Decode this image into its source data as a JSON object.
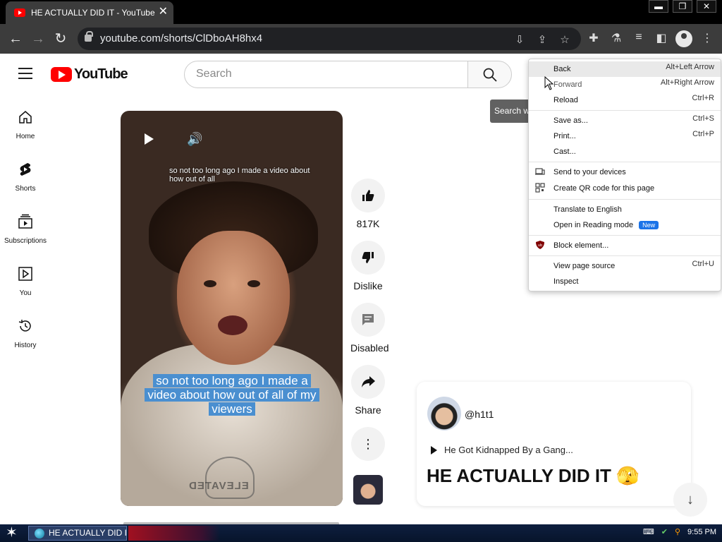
{
  "browser": {
    "tab_title": "HE ACTUALLY DID IT  - YouTube",
    "tab_close": "✕",
    "url": "youtube.com/shorts/ClDboAH8hx4",
    "window_controls": [
      "▬",
      "❐",
      "✕"
    ]
  },
  "youtube": {
    "logo_text": "YouTube",
    "search_placeholder": "Search",
    "search_tooltip": "Search with your voice",
    "sidebar": [
      {
        "label": "Home",
        "icon": "home-icon"
      },
      {
        "label": "Shorts",
        "icon": "shorts-icon"
      },
      {
        "label": "Subscriptions",
        "icon": "subscriptions-icon"
      },
      {
        "label": "You",
        "icon": "you-icon"
      },
      {
        "label": "History",
        "icon": "history-icon"
      }
    ],
    "video": {
      "caption_top": "so not too long ago I made a video about how out of all",
      "caption_main": "so not too long ago I made a video about how out of all of my viewers",
      "shirt_text": "ELEVATED"
    },
    "actions": {
      "like_count": "817K",
      "dislike_label": "Dislike",
      "comments_label": "Disabled",
      "share_label": "Share"
    },
    "info": {
      "handle": "@h1t1",
      "sound": "He Got Kidnapped By a Gang...",
      "title": "HE ACTUALLY DID IT 🫣"
    }
  },
  "context_menu": {
    "items": [
      {
        "label": "Back",
        "shortcut": "Alt+Left Arrow"
      },
      {
        "label": "Forward",
        "shortcut": "Alt+Right Arrow"
      },
      {
        "label": "Reload",
        "shortcut": "Ctrl+R"
      },
      {
        "label": "Save as...",
        "shortcut": "Ctrl+S"
      },
      {
        "label": "Print...",
        "shortcut": "Ctrl+P"
      },
      {
        "label": "Cast...",
        "shortcut": ""
      },
      {
        "label": "Send to your devices",
        "shortcut": ""
      },
      {
        "label": "Create QR code for this page",
        "shortcut": ""
      },
      {
        "label": "Translate to English",
        "shortcut": ""
      },
      {
        "label": "Open in Reading mode",
        "shortcut": "",
        "badge": "New"
      },
      {
        "label": "Block element...",
        "shortcut": ""
      },
      {
        "label": "View page source",
        "shortcut": "Ctrl+U"
      },
      {
        "label": "Inspect",
        "shortcut": ""
      }
    ]
  },
  "taskbar": {
    "task_label": "HE ACTUALLY DID I...",
    "clock": "9:55 PM"
  }
}
